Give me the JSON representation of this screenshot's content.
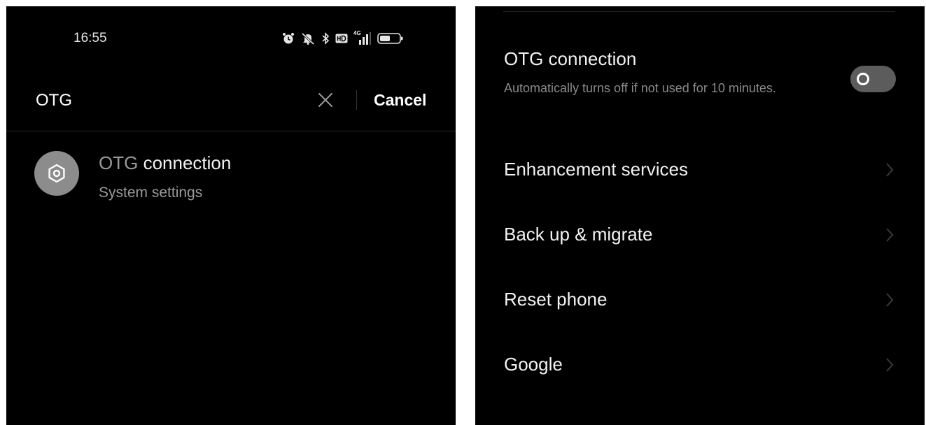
{
  "search_screen": {
    "status_bar": {
      "time": "16:55",
      "network_label": "4G",
      "icons": [
        "alarm-icon",
        "mute-icon",
        "bluetooth-icon",
        "hd-icon",
        "signal-icon",
        "battery-icon"
      ]
    },
    "search": {
      "query": "OTG",
      "cancel_label": "Cancel"
    },
    "results": [
      {
        "title_match": "OTG",
        "title_rest": " connection",
        "subtitle": "System settings",
        "icon": "settings-hexagon-icon"
      }
    ]
  },
  "settings_screen": {
    "otg": {
      "title": "OTG connection",
      "description": "Automatically turns off if not used for 10 minutes.",
      "toggle_on": false
    },
    "items": [
      {
        "label": "Enhancement services"
      },
      {
        "label": "Back up & migrate"
      },
      {
        "label": "Reset phone"
      },
      {
        "label": "Google"
      }
    ]
  },
  "colors": {
    "background": "#000000",
    "primary_text": "#f2f2f2",
    "secondary_text": "#9a9a9a",
    "toggle_track": "#5c5c5c",
    "result_icon_bg": "#8c8c8c"
  }
}
